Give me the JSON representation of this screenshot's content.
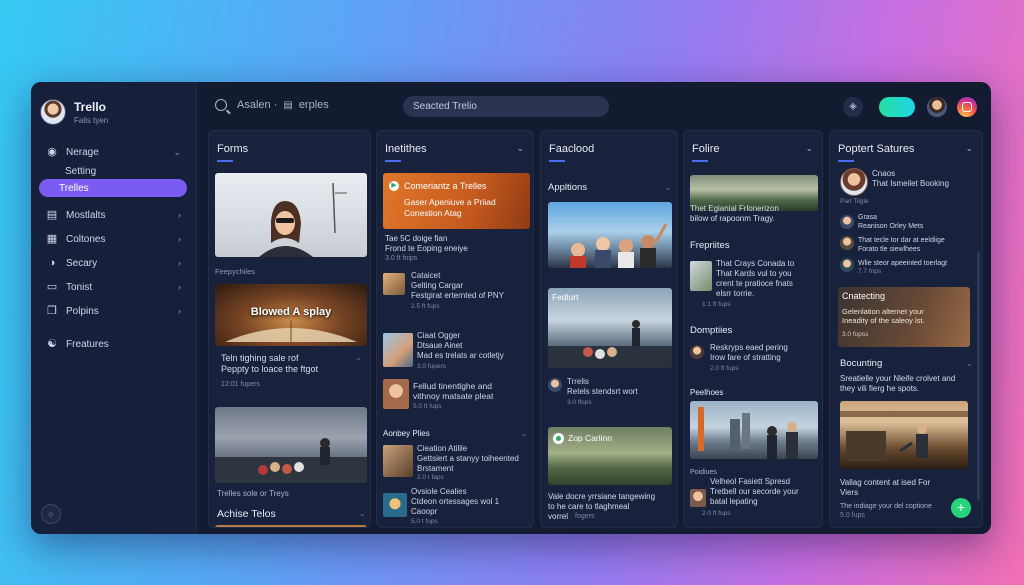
{
  "app": {
    "name": "Trello",
    "subtitle": "Falis tyen"
  },
  "sidebar": {
    "items": [
      {
        "label": "Nerage",
        "icon": "question-icon",
        "chevron": true
      },
      {
        "label": "Setting",
        "icon": "",
        "chevron": false
      },
      {
        "label": "Trelles",
        "icon": "",
        "chevron": false,
        "active": true
      },
      {
        "label": "Mostlalts",
        "icon": "list-icon",
        "chevron": true
      },
      {
        "label": "Coltones",
        "icon": "grid-icon",
        "chevron": true
      },
      {
        "label": "Secary",
        "icon": "shield-icon",
        "chevron": true
      },
      {
        "label": "Tonist",
        "icon": "card-icon",
        "chevron": true
      },
      {
        "label": "Polpins",
        "icon": "copy-icon",
        "chevron": true
      },
      {
        "label": "Freatures",
        "icon": "people-icon",
        "chevron": false
      }
    ]
  },
  "header": {
    "search_text": "Asalen · ",
    "search_suffix": "erples",
    "board_label": "Seacted Trelio"
  },
  "columns": [
    {
      "title": "Forms",
      "cards": [
        {
          "caption": "Feepychiles"
        },
        {
          "image_title": "Blowed A splay",
          "caption": "Teln tighing sale rof\nPeppty to loace the ftgot",
          "meta": "12:01 fupers"
        },
        {
          "caption": "Trelles sole or Treys"
        }
      ],
      "footer": "Achise Telos"
    },
    {
      "title": "Inetithes",
      "banner": {
        "title": "Comeriantz a Trelles",
        "text": "Gaser Apeniuve a Priiad\nConestion Atag"
      },
      "banner_caption": "Tae 5C doige fian\nFrond te Eoping eneiye",
      "banner_meta": "3.0 ft fnips",
      "rows": [
        {
          "text": "Cataicet\nGelting Cargar\nFestgirat erternted of PNY",
          "meta": "2.5 ft fups"
        },
        {
          "text": "Ciaat Ogger\nDtsaue Ainet\nMad es trelats ar cotletjy",
          "meta": "3.0 fupers"
        },
        {
          "text": "Fellud tinentlghe and\nvithnoy matsate pleat",
          "meta": "5.0 ft fups"
        }
      ],
      "section": "Aonbey Plies",
      "rows2": [
        {
          "text": "Cieation Atilile\nGettsiert a stanyy toiheented\nBrstament",
          "meta": "2.0 t faps"
        },
        {
          "text": "Ovsiole Cealies\nCtdeon ortessages wol 1\nCaoopr",
          "meta": "5.0 t fups"
        }
      ]
    },
    {
      "title": "Faaclood",
      "section1": "Appltions",
      "section2": "Fedlurt",
      "row": {
        "text": "Trrelis\nRetels stendsrt wort",
        "meta": "3.0 flops"
      },
      "chip": "Zop Carlinn",
      "caption": "Vale docre yrrsiane tangewing\nto he care to tlaghmeal\nvorrel",
      "caption_meta": "fogers"
    },
    {
      "title": "Folire",
      "caption1": "Thet Egianial Frlonerizon\nbilow of rapoonm Tragy.",
      "section1": "Frepriites",
      "row1": {
        "text": "That Crays Conada to\nThat Kards vul to you\ncrent te pratioce fnats\nelsrr torrie.",
        "meta": "1:1 ft fups"
      },
      "section2": "Domptiies",
      "row2": {
        "text": "Reskryps eaed pering\nIrow fare of stratting",
        "meta": "2.0 ft fups"
      },
      "section3": "Peelhoes",
      "caption3_label": "Poidiues",
      "row3": {
        "text": "Velheol Fasiett Spresd\nTretbell our secorde your\nbatal lepating",
        "meta": "2.0 ft fups"
      }
    },
    {
      "title": "Poptert Satures",
      "head_row": {
        "text": "Cnaos\nThat Ismeilet Booking",
        "meta": "Parl Tilgle"
      },
      "rows": [
        {
          "text": "Grasa\nReanison Orley Mets",
          "meta": ""
        },
        {
          "text": "That tecle tor dar at eeldiige\nForato tle siewlhees",
          "meta": ""
        },
        {
          "text": "Wlie steor apeeinted toerlagt",
          "meta": "7.7 fnps"
        }
      ],
      "card1": {
        "title": "Cnatecting",
        "text": "Gelenlation alternet your\nIneadity of the saleoy lst.",
        "meta": "3.0 fupss"
      },
      "section2": "Bocunting",
      "section2_text": "Sreatielle your Nleife crolvet and\nthey vili fierg he spots.",
      "footer_text": "Vallag content at ised For\nViers",
      "footer_sub": "The indiage your del coptione",
      "footer_meta": "5.0 fups"
    }
  ],
  "colors": {
    "accent": "#7a5cf2",
    "toggle": "#26e0a0",
    "fab": "#28d47b",
    "underline": "#4b6cf0"
  }
}
